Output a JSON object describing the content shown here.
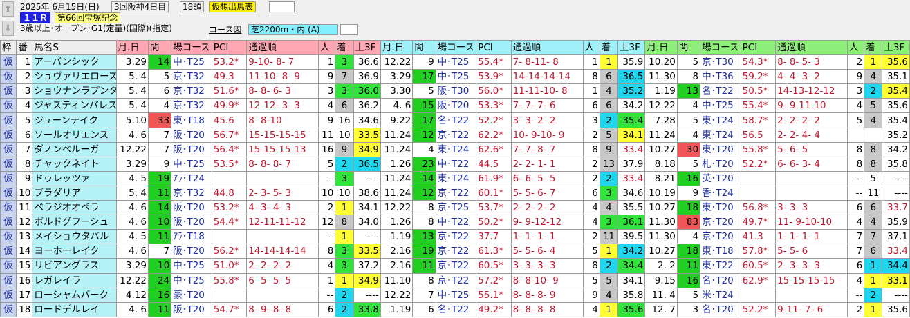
{
  "header": {
    "date": "2025年 6月15日(日)",
    "meet": "3回阪神4日目",
    "field": "18頭",
    "title": "仮想出馬表",
    "race_no": "１１Ｒ",
    "race_name": "第66回宝塚記念",
    "conditions": "3歳以上･オープン･G1(定量)(国際)(指定)",
    "course_label": "コース図",
    "course": "芝2200m・内 (A)",
    "prev_icon": "prev-arrow",
    "next_icon": "next-arrow"
  },
  "columns": {
    "gate": "枠",
    "num": "番",
    "name": "馬名S",
    "date": "月.日",
    "gap": "間",
    "course": "場コース",
    "pci": "PCI",
    "passing": "通過順",
    "pop": "人",
    "finish": "着",
    "last3f": "上3F"
  },
  "rows": [
    {
      "gate": "仮",
      "num": "1",
      "name": "アーバンシック",
      "runs": [
        {
          "date": "3.29",
          "gap": "14",
          "gb": "gf",
          "course": "中･T25",
          "pci": "53.2*",
          "pg": 0,
          "pass": "9-10- 8- 7",
          "pop": "1",
          "fin": "3",
          "fc": "q3",
          "l3": "36.6",
          "lc": "q0"
        },
        {
          "date": "12.22",
          "gap": "9",
          "gb": "",
          "course": "中･T25",
          "pci": "55.4*",
          "pg": 0,
          "pass": "7- 8-11- 8",
          "pop": "1",
          "fin": "1",
          "fc": "q1",
          "l3": "35.9",
          "lc": "q0"
        },
        {
          "date": "10.20",
          "gap": "5",
          "gb": "",
          "course": "京･T30",
          "pci": "54.3*",
          "pg": 0,
          "pass": "8- 8- 5- 3",
          "pop": "2",
          "fin": "1",
          "fc": "q1",
          "l3": "35.6",
          "lc": "q1"
        }
      ]
    },
    {
      "gate": "仮",
      "num": "2",
      "name": "シュヴァリエローズ",
      "runs": [
        {
          "date": "5. 4",
          "gap": "5",
          "gb": "",
          "course": "京･T32",
          "pci": "49.3",
          "pg": 1,
          "pass": "11-10- 8- 9",
          "pop": "9",
          "fin": "7",
          "fc": "q4",
          "l3": "36.9",
          "lc": "q0"
        },
        {
          "date": "3.29",
          "gap": "17",
          "gb": "gf",
          "course": "中･T25",
          "pci": "53.9*",
          "pg": 0,
          "pass": "14-14-14-14",
          "pop": "8",
          "fin": "6",
          "fc": "q4",
          "l3": "36.5",
          "lc": "q2"
        },
        {
          "date": "11.30",
          "gap": "8",
          "gb": "",
          "course": "中･T36",
          "pci": "59.2*",
          "pg": 0,
          "pass": "4- 4- 3- 2",
          "pop": "9",
          "fin": "4",
          "fc": "q4",
          "l3": "35.1",
          "lc": "q0"
        }
      ]
    },
    {
      "gate": "仮",
      "num": "3",
      "name": "ショウナンラプンタ",
      "runs": [
        {
          "date": "5. 4",
          "gap": "6",
          "gb": "",
          "course": "京･T32",
          "pci": "51.6*",
          "pg": 0,
          "pass": "8- 8- 6- 3",
          "pop": "3",
          "fin": "3",
          "fc": "q3",
          "l3": "36.0",
          "lc": "q3"
        },
        {
          "date": "3.30",
          "gap": "5",
          "gb": "",
          "course": "阪･T30",
          "pci": "56.0*",
          "pg": 0,
          "pass": "11-11-10- 8",
          "pop": "1",
          "fin": "4",
          "fc": "q4",
          "l3": "35.2",
          "lc": "q2"
        },
        {
          "date": "1.19",
          "gap": "13",
          "gb": "gf",
          "course": "名･T22",
          "pci": "50.5*",
          "pg": 0,
          "pass": "14-13-12-12",
          "pop": "3",
          "fin": "2",
          "fc": "q2",
          "l3": "35.4",
          "lc": "q1"
        }
      ]
    },
    {
      "gate": "仮",
      "num": "4",
      "name": "ジャスティンパレス",
      "runs": [
        {
          "date": "5. 4",
          "gap": "4",
          "gb": "",
          "course": "京･T32",
          "pci": "49.9*",
          "pg": 0,
          "pass": "12-12- 3- 3",
          "pop": "4",
          "fin": "6",
          "fc": "q4",
          "l3": "36.2",
          "lc": "q0"
        },
        {
          "date": "4. 6",
          "gap": "15",
          "gb": "gf",
          "course": "阪･T20",
          "pci": "53.3*",
          "pg": 0,
          "pass": "7- 7- 7- 6",
          "pop": "6",
          "fin": "6",
          "fc": "q4",
          "l3": "34.2",
          "lc": "q0"
        },
        {
          "date": "12.22",
          "gap": "4",
          "gb": "",
          "course": "中･T25",
          "pci": "55.4*",
          "pg": 0,
          "pass": "9- 9-11-10",
          "pop": "4",
          "fin": "5",
          "fc": "q4",
          "l3": "35.6",
          "lc": "q0"
        }
      ]
    },
    {
      "gate": "仮",
      "num": "5",
      "name": "ジューンテイク",
      "runs": [
        {
          "date": "5.10",
          "gap": "33",
          "gb": "rf",
          "course": "東･T18",
          "pci": "45.6",
          "pg": 1,
          "pass": "8- 8-10",
          "pop": "9",
          "fin": "16",
          "fc": "q0",
          "l3": "34.6",
          "lc": "q0"
        },
        {
          "date": "9.22",
          "gap": "17",
          "gb": "gf",
          "course": "名･T22",
          "pci": "52.2*",
          "pg": 0,
          "pass": "3- 3- 2- 2",
          "pop": "3",
          "fin": "2",
          "fc": "q2",
          "l3": "35.4",
          "lc": "q3"
        },
        {
          "date": "7.28",
          "gap": "5",
          "gb": "",
          "course": "東･T24",
          "pci": "58.7*",
          "pg": 0,
          "pass": "2- 2- 2- 2",
          "pop": "5",
          "fin": "4",
          "fc": "q4",
          "l3": "35.4",
          "lc": "q0"
        }
      ]
    },
    {
      "gate": "仮",
      "num": "6",
      "name": "ソールオリエンス",
      "runs": [
        {
          "date": "4. 6",
          "gap": "7",
          "gb": "",
          "course": "阪･T20",
          "pci": "56.7*",
          "pg": 0,
          "pass": "15-15-15-15",
          "pop": "11",
          "fin": "10",
          "fc": "q0",
          "l3": "33.5",
          "lc": "q1"
        },
        {
          "date": "11.24",
          "gap": "12",
          "gb": "gf",
          "course": "京･T22",
          "pci": "62.2*",
          "pg": 0,
          "pass": "10- 9-10- 9",
          "pop": "2",
          "fin": "5",
          "fc": "q4",
          "l3": "34.1",
          "lc": "q1"
        },
        {
          "date": "11.24",
          "gap": "4",
          "gb": "",
          "course": "東･T24",
          "pci": "56.5",
          "pg": 1,
          "pass": "2- 2- 4- 4",
          "pop": "",
          "fin": "",
          "fc": "q0",
          "l3": "35.2",
          "lc": "q0"
        }
      ]
    },
    {
      "gate": "仮",
      "num": "7",
      "name": "ダノンベルーガ",
      "runs": [
        {
          "date": "12.22",
          "gap": "7",
          "gb": "",
          "course": "阪･T20",
          "pci": "56.4*",
          "pg": 0,
          "pass": "15-15-15-13",
          "pop": "16",
          "fin": "9",
          "fc": "q4",
          "l3": "34.9",
          "lc": "q1"
        },
        {
          "date": "11.24",
          "gap": "4",
          "gb": "",
          "course": "東･T24",
          "pci": "62.6*",
          "pg": 0,
          "pass": "7- 7- 8- 7",
          "pop": "8",
          "fin": "9",
          "fc": "q4",
          "l3": "33.4",
          "lc": "pink"
        },
        {
          "date": "10.27",
          "gap": "30",
          "gb": "rf",
          "course": "東･T20",
          "pci": "55.8*",
          "pg": 0,
          "pass": "5- 6- 5",
          "pop": "8",
          "fin": "8",
          "fc": "q4",
          "l3": "34.2",
          "lc": "q0"
        }
      ]
    },
    {
      "gate": "仮",
      "num": "8",
      "name": "チャックネイト",
      "runs": [
        {
          "date": "3.29",
          "gap": "9",
          "gb": "",
          "course": "中･T25",
          "pci": "53.5*",
          "pg": 0,
          "pass": "8- 8- 8- 7",
          "pop": "5",
          "fin": "2",
          "fc": "q2",
          "l3": "36.5",
          "lc": "q2"
        },
        {
          "date": "1.26",
          "gap": "23",
          "gb": "gf",
          "course": "中･T22",
          "pci": "44.5",
          "pg": 1,
          "pass": "2- 2- 1- 1",
          "pop": "2",
          "fin": "13",
          "fc": "q4",
          "l3": "37.9",
          "lc": "q0"
        },
        {
          "date": "8.18",
          "gap": "5",
          "gb": "",
          "course": "札･T20",
          "pci": "52.2*",
          "pg": 0,
          "pass": "6- 6- 3- 4",
          "pop": "8",
          "fin": "8",
          "fc": "q4",
          "l3": "35.8",
          "lc": "q0"
        }
      ]
    },
    {
      "gate": "仮",
      "num": "9",
      "name": "ドゥレッツァ",
      "runs": [
        {
          "date": "4. 5",
          "gap": "19",
          "gb": "gf",
          "course": "ｱﾗ･T24",
          "pci": "",
          "pg": 0,
          "pass": "",
          "pop": "--",
          "fin": "3",
          "fc": "q3",
          "l3": "----",
          "lc": "q0"
        },
        {
          "date": "11.24",
          "gap": "14",
          "gb": "gf",
          "course": "東･T24",
          "pci": "61.9*",
          "pg": 0,
          "pass": "6- 6- 5- 5",
          "pop": "2",
          "fin": "2",
          "fc": "q2",
          "l3": "33.4",
          "lc": "pink"
        },
        {
          "date": "8.21",
          "gap": "16",
          "gb": "gf",
          "course": "英･T20",
          "pci": "",
          "pg": 0,
          "pass": "",
          "pop": "--",
          "fin": "5",
          "fc": "q0",
          "l3": "----",
          "lc": "q0"
        }
      ]
    },
    {
      "gate": "仮",
      "num": "10",
      "name": "ブラダリア",
      "runs": [
        {
          "date": "5. 4",
          "gap": "11",
          "gb": "gf",
          "course": "京･T32",
          "pci": "44.8",
          "pg": 1,
          "pass": "2- 3- 5- 3",
          "pop": "10",
          "fin": "10",
          "fc": "q0",
          "l3": "38.6",
          "lc": "q0"
        },
        {
          "date": "11.24",
          "gap": "12",
          "gb": "gf",
          "course": "京･T22",
          "pci": "60.1*",
          "pg": 0,
          "pass": "5- 5- 6- 7",
          "pop": "6",
          "fin": "3",
          "fc": "q3",
          "l3": "34.6",
          "lc": "q0"
        },
        {
          "date": "10.19",
          "gap": "9",
          "gb": "",
          "course": "香･T24",
          "pci": "",
          "pg": 0,
          "pass": "",
          "pop": "--",
          "fin": "11",
          "fc": "q0",
          "l3": "----",
          "lc": "q0"
        }
      ]
    },
    {
      "gate": "仮",
      "num": "11",
      "name": "ベラジオオペラ",
      "runs": [
        {
          "date": "4. 6",
          "gap": "14",
          "gb": "gf",
          "course": "阪･T20",
          "pci": "53.2*",
          "pg": 0,
          "pass": "4- 3- 4- 3",
          "pop": "2",
          "fin": "1",
          "fc": "q1",
          "l3": "34.1",
          "lc": "q0"
        },
        {
          "date": "12.22",
          "gap": "8",
          "gb": "",
          "course": "京･T25",
          "pci": "53.7*",
          "pg": 0,
          "pass": "2- 2- 2- 2",
          "pop": "4",
          "fin": "4",
          "fc": "q4",
          "l3": "35.5",
          "lc": "q0"
        },
        {
          "date": "10.27",
          "gap": "18",
          "gb": "gf",
          "course": "東･T20",
          "pci": "56.8*",
          "pg": 0,
          "pass": "3- 3- 3",
          "pop": "6",
          "fin": "6",
          "fc": "q4",
          "l3": "33.7",
          "lc": "pink"
        }
      ]
    },
    {
      "gate": "仮",
      "num": "12",
      "name": "ボルドグフーシュ",
      "runs": [
        {
          "date": "4. 6",
          "gap": "10",
          "gb": "gf",
          "course": "阪･T20",
          "pci": "54.4*",
          "pg": 0,
          "pass": "12-11-11-12",
          "pop": "12",
          "fin": "8",
          "fc": "q4",
          "l3": "34.0",
          "lc": "q0"
        },
        {
          "date": "1.26",
          "gap": "8",
          "gb": "",
          "course": "中･T22",
          "pci": "50.2*",
          "pg": 0,
          "pass": "9- 9-12-12",
          "pop": "4",
          "fin": "3",
          "fc": "q3",
          "l3": "36.1",
          "lc": "q3"
        },
        {
          "date": "11.30",
          "gap": "83",
          "gb": "rf",
          "course": "京･T20",
          "pci": "49.7*",
          "pg": 0,
          "pass": "11- 9-10-10",
          "pop": "4",
          "fin": "4",
          "fc": "q4",
          "l3": "35.9",
          "lc": "q0"
        }
      ]
    },
    {
      "gate": "仮",
      "num": "13",
      "name": "メイショウタバル",
      "runs": [
        {
          "date": "4. 5",
          "gap": "11",
          "gb": "gf",
          "course": "ｱﾗ･T18",
          "pci": "",
          "pg": 0,
          "pass": "",
          "pop": "--",
          "fin": "1",
          "fc": "q1",
          "l3": "----",
          "lc": "q0"
        },
        {
          "date": "1.19",
          "gap": "13",
          "gb": "gf",
          "course": "京･T22",
          "pci": "37.7",
          "pg": 1,
          "pass": "1- 1- 1- 1",
          "pop": "2",
          "fin": "11",
          "fc": "q4",
          "l3": "39.5",
          "lc": "q0"
        },
        {
          "date": "11.30",
          "gap": "4",
          "gb": "",
          "course": "京･T20",
          "pci": "41.3",
          "pg": 1,
          "pass": "1- 1- 1- 1",
          "pop": "7",
          "fin": "7",
          "fc": "q4",
          "l3": "37.1",
          "lc": "q0"
        }
      ]
    },
    {
      "gate": "仮",
      "num": "14",
      "name": "ヨーホーレイク",
      "runs": [
        {
          "date": "4. 6",
          "gap": "7",
          "gb": "",
          "course": "阪･T20",
          "pci": "56.2*",
          "pg": 0,
          "pass": "14-14-14-14",
          "pop": "8",
          "fin": "3",
          "fc": "q3",
          "l3": "33.5",
          "lc": "q1"
        },
        {
          "date": "2.16",
          "gap": "19",
          "gb": "gf",
          "course": "京･T22",
          "pci": "61.3*",
          "pg": 0,
          "pass": "5- 5- 6- 4",
          "pop": "5",
          "fin": "1",
          "fc": "q1",
          "l3": "34.2",
          "lc": "q2"
        },
        {
          "date": "10.27",
          "gap": "18",
          "gb": "gf",
          "course": "東･T18",
          "pci": "57.8*",
          "pg": 0,
          "pass": "5- 5- 6",
          "pop": "7",
          "fin": "6",
          "fc": "q4",
          "l3": "33.4",
          "lc": "pink"
        }
      ]
    },
    {
      "gate": "仮",
      "num": "15",
      "name": "リビアングラス",
      "runs": [
        {
          "date": "3.29",
          "gap": "10",
          "gb": "gf",
          "course": "中･T25",
          "pci": "51.0*",
          "pg": 0,
          "pass": "2- 2- 2- 2",
          "pop": "4",
          "fin": "3",
          "fc": "q3",
          "l3": "37.2",
          "lc": "q0"
        },
        {
          "date": "2.16",
          "gap": "11",
          "gb": "gf",
          "course": "京･T22",
          "pci": "60.5*",
          "pg": 0,
          "pass": "3- 3- 3- 3",
          "pop": "8",
          "fin": "2",
          "fc": "q2",
          "l3": "34.4",
          "lc": "q3"
        },
        {
          "date": "2. 2",
          "gap": "11",
          "gb": "gf",
          "course": "東･T22",
          "pci": "60.5*",
          "pg": 0,
          "pass": "2- 3- 3- 3",
          "pop": "6",
          "fin": "1",
          "fc": "q2",
          "l3": "34.4",
          "lc": "q2"
        }
      ]
    },
    {
      "gate": "仮",
      "num": "16",
      "name": "レガレイラ",
      "runs": [
        {
          "date": "12.22",
          "gap": "24",
          "gb": "gf",
          "course": "中･T25",
          "pci": "55.8*",
          "pg": 0,
          "pass": "6- 5- 5- 5",
          "pop": "1",
          "fin": "1",
          "fc": "q1",
          "l3": "34.9",
          "lc": "q1"
        },
        {
          "date": "11.10",
          "gap": "8",
          "gb": "",
          "course": "京･T22",
          "pci": "57.2*",
          "pg": 0,
          "pass": "8- 8-10- 9",
          "pop": "5",
          "fin": "5",
          "fc": "q4",
          "l3": "34.1",
          "lc": "q0"
        },
        {
          "date": "9.15",
          "gap": "16",
          "gb": "gf",
          "course": "名･T20",
          "pci": "62.9*",
          "pg": 0,
          "pass": "15-15-15-15",
          "pop": "4",
          "fin": "1",
          "fc": "q1",
          "l3": "33.1",
          "lc": "q1"
        }
      ]
    },
    {
      "gate": "仮",
      "num": "17",
      "name": "ローシャムパーク",
      "runs": [
        {
          "date": "4.12",
          "gap": "16",
          "gb": "gf",
          "course": "豪･T20",
          "pci": "",
          "pg": 0,
          "pass": "",
          "pop": "--",
          "fin": "2",
          "fc": "q2",
          "l3": "----",
          "lc": "q0"
        },
        {
          "date": "12.22",
          "gap": "7",
          "gb": "",
          "course": "中･T25",
          "pci": "55.1*",
          "pg": 0,
          "pass": "8- 8- 8- 9",
          "pop": "9",
          "fin": "4",
          "fc": "q4",
          "l3": "35.8",
          "lc": "q0"
        },
        {
          "date": "11. 4",
          "gap": "5",
          "gb": "",
          "course": "米･T24",
          "pci": "",
          "pg": 0,
          "pass": "",
          "pop": "--",
          "fin": "2",
          "fc": "q2",
          "l3": "----",
          "lc": "q0"
        }
      ]
    },
    {
      "gate": "仮",
      "num": "18",
      "name": "ロードデルレイ",
      "runs": [
        {
          "date": "4. 6",
          "gap": "11",
          "gb": "gf",
          "course": "阪･T20",
          "pci": "54.7*",
          "pg": 0,
          "pass": "8- 9- 8- 8",
          "pop": "6",
          "fin": "2",
          "fc": "q2",
          "l3": "33.8",
          "lc": "q3"
        },
        {
          "date": "1.19",
          "gap": "6",
          "gb": "",
          "course": "名･T22",
          "pci": "49.2*",
          "pg": 0,
          "pass": "8- 8- 8- 8",
          "pop": "4",
          "fin": "1",
          "fc": "q1",
          "l3": "35.6",
          "lc": "q3"
        },
        {
          "date": "12. 7",
          "gap": "3",
          "gb": "",
          "course": "名･T20",
          "pci": "52.2*",
          "pg": 0,
          "pass": "9-11- 7- 6",
          "pop": "2",
          "fin": "1",
          "fc": "q1",
          "l3": "35.6",
          "lc": "q0"
        }
      ]
    }
  ]
}
